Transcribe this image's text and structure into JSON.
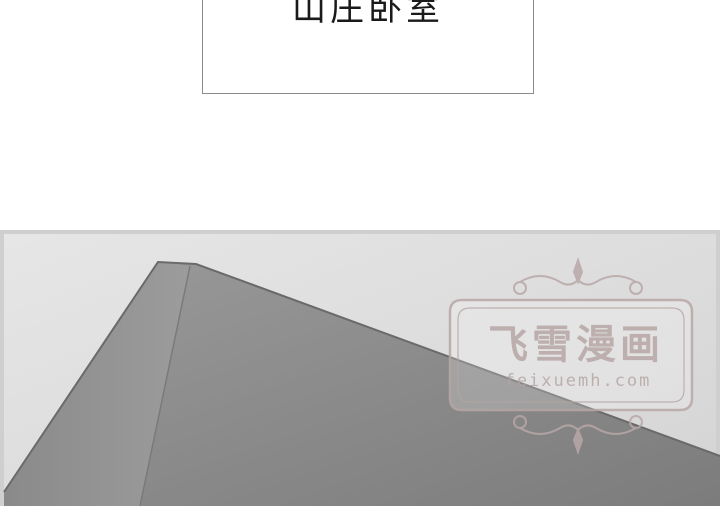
{
  "caption": {
    "text": "山庄卧室"
  },
  "watermark": {
    "title": "飞雪漫画",
    "url": "feixuemh.com",
    "color": "#b9a8a8"
  },
  "colors": {
    "frame_border": "#d9d9d9",
    "backdrop": "#e3e3e3",
    "object_face": "#8c8c8c",
    "object_edge": "#6e6e6e"
  }
}
